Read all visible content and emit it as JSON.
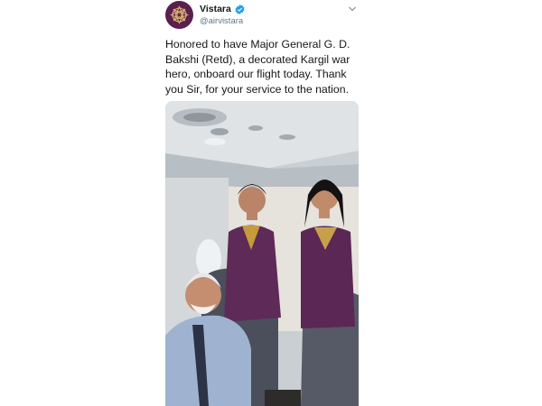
{
  "tweet": {
    "account_name": "Vistara",
    "handle": "@airvistara",
    "verified": true,
    "text": "Honored to have Major General G. D. Bakshi (Retd), a decorated Kargil war hero, onboard our flight today. Thank you Sir, for your service to the nation.",
    "avatar_icon": "vistara-logo-icon",
    "menu_icon": "chevron-down-icon",
    "photo_icon": "cabin-photo"
  },
  "colors": {
    "brand": "#5a1f4f",
    "verified": "#1da1f2",
    "text": "#14171a",
    "muted": "#657786"
  }
}
